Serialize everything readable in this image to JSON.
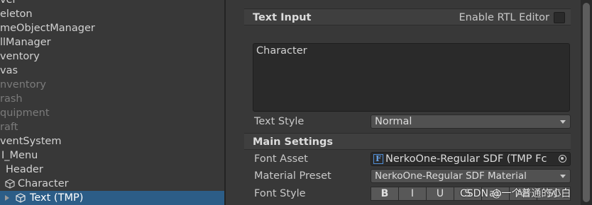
{
  "hierarchy": {
    "items": [
      {
        "label": "ver",
        "state": "normal"
      },
      {
        "label": "eleton",
        "state": "normal"
      },
      {
        "label": "meObjectManager",
        "state": "normal"
      },
      {
        "label": "llManager",
        "state": "normal"
      },
      {
        "label": "ventory",
        "state": "normal"
      },
      {
        "label": "vas",
        "state": "normal"
      },
      {
        "label": "nventory",
        "state": "disabled"
      },
      {
        "label": "rash",
        "state": "disabled"
      },
      {
        "label": "quipment",
        "state": "disabled"
      },
      {
        "label": "raft",
        "state": "disabled"
      },
      {
        "label": "ventSystem",
        "state": "normal"
      },
      {
        "label": "I_Menu",
        "state": "normal"
      },
      {
        "label": "Header",
        "state": "normal"
      },
      {
        "label": "Character",
        "state": "normal"
      },
      {
        "label": "Text (TMP)",
        "state": "selected"
      }
    ]
  },
  "inspector": {
    "text_input": {
      "title": "Text Input",
      "rtl_label": "Enable RTL Editor",
      "rtl_checked": false,
      "value": "Character"
    },
    "text_style": {
      "label": "Text Style",
      "value": "Normal"
    },
    "main_settings": {
      "title": "Main Settings",
      "font_asset_label": "Font Asset",
      "font_asset_value": "NerkoOne-Regular SDF (TMP Fc",
      "material_preset_label": "Material Preset",
      "material_preset_value": "NerkoOne-Regular SDF Material",
      "font_style_label": "Font Style",
      "style_buttons": [
        "B",
        "I",
        "U",
        "S",
        "ab",
        "AB",
        "SC"
      ]
    }
  },
  "watermark": "CSDN @一个普通的小白",
  "colors": {
    "selection": "#2c5d87",
    "panel": "#383838",
    "field": "#2a2a2a",
    "font_icon": "#4f8dd6"
  }
}
